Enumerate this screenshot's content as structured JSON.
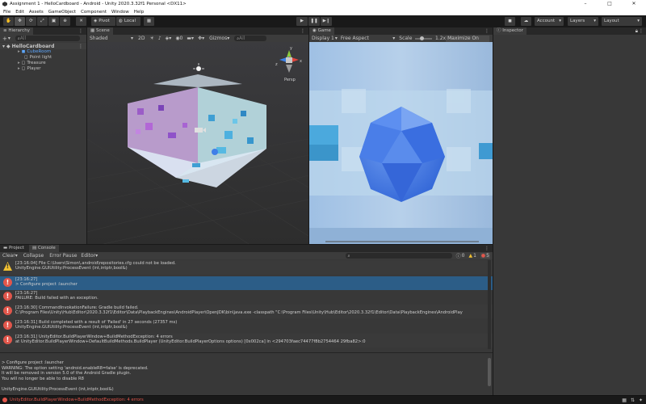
{
  "window": {
    "title": "Assignment 1 - HelloCardboard - Android - Unity 2020.3.32f1 Personal <DX11>",
    "minimize": "–",
    "maximize": "□",
    "close": "✕"
  },
  "menu": [
    "File",
    "Edit",
    "Assets",
    "GameObject",
    "Component",
    "Window",
    "Help"
  ],
  "toolbar": {
    "pivot_label": "Pivot",
    "local_label": "Local",
    "account_label": "Account",
    "layers_label": "Layers",
    "layout_label": "Layout"
  },
  "hierarchy": {
    "tab_label": "Hierarchy",
    "search_placeholder": "All",
    "scene_name": "HelloCardboard",
    "items": [
      "CubeRoom",
      "Point light",
      "Treasure",
      "Player"
    ]
  },
  "scene": {
    "tab_label": "Scene",
    "shading_mode": "Shaded",
    "view_2d_label": "2D",
    "gizmos_label": "Gizmos",
    "search_placeholder": "All",
    "persp_label": "Persp",
    "axis_labels": [
      "y",
      "x",
      "z"
    ]
  },
  "game": {
    "tab_label": "Game",
    "display_label": "Display 1",
    "aspect_label": "Free Aspect",
    "scale_label": "Scale",
    "scale_value": "1.2x",
    "maximize_label": "Maximize On Play",
    "scale_level": 0.3
  },
  "inspector": {
    "tab_label": "Inspector"
  },
  "console": {
    "project_tab": "Project",
    "console_tab": "Console",
    "clear_label": "Clear",
    "collapse_label": "Collapse",
    "error_pause_label": "Error Pause",
    "editor_label": "Editor",
    "info_count": "0",
    "warn_count": "1",
    "error_count": "5",
    "entries": [
      {
        "type": "warning",
        "line1": "[23:16:04]  File C:\\Users\\Simon\\.android\\repositories.cfg could not be loaded.",
        "line2": "UnityEngine.GUIUtility:ProcessEvent (int,intptr,bool&)"
      },
      {
        "type": "error",
        "line1": "[23:16:27]",
        "line2": "> Configure project :launcher"
      },
      {
        "type": "error",
        "line1": "[23:16:27]",
        "line2": "FAILURE: Build failed with an exception."
      },
      {
        "type": "error",
        "line1": "[23:16:30] CommandInvokationFailure: Gradle build failed.",
        "line2": "C:\\Program Files\\Unity\\Hub\\Editor\\2020.3.32f1\\Editor\\Data\\PlaybackEngines\\AndroidPlayer\\OpenJDK\\bin\\java.exe -classpath \"C:\\Program Files\\Unity\\Hub\\Editor\\2020.3.32f1\\Editor\\Data\\PlaybackEngines\\AndroidPlay"
      },
      {
        "type": "error",
        "line1": "[23:16:31] Build completed with a result of 'Failed' in 27 seconds (27357 ms)",
        "line2": "UnityEngine.GUIUtility:ProcessEvent (int,intptr,bool&)"
      },
      {
        "type": "error",
        "line1": "[23:16:31] UnityEditor.BuildPlayerWindow+BuildMethodException: 4 errors",
        "line2": "  at UnityEditor.BuildPlayerWindow+DefaultBuildMethods.BuildPlayer (UnityEditor.BuildPlayerOptions options) [0x002ca] in <294703faec74477f8b2754464 29fba82>:0"
      }
    ],
    "detail_lines": [
      "> Configure project :launcher",
      "WARNING: The option setting 'android.enableR8=false' is deprecated.",
      "It will be removed in version 5.0 of the Android Gradle plugin.",
      "You will no longer be able to disable R8",
      "",
      "UnityEngine.GUIUtility:ProcessEvent (int,intptr,bool&)"
    ],
    "status_message": "UnityEditor.BuildPlayerWindow+BuildMethodException: 4 errors"
  },
  "colors": {
    "selection": "#2c5d87",
    "error": "#e1564b",
    "warning": "#f0c032",
    "panel": "#383838",
    "game_bg": "#a9c7e6"
  }
}
